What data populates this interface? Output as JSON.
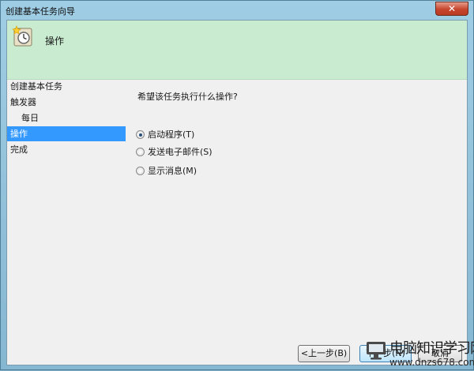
{
  "window": {
    "title": "创建基本任务向导",
    "close_glyph": "✕"
  },
  "header": {
    "title": "操作",
    "icon": "task-scheduler-clock-icon"
  },
  "steps": [
    {
      "label": "创建基本任务",
      "active": false
    },
    {
      "label": "触发器",
      "active": false
    },
    {
      "label": "每日",
      "active": false,
      "sub": true
    },
    {
      "label": "操作",
      "active": true
    },
    {
      "label": "完成",
      "active": false
    }
  ],
  "main": {
    "question": "希望该任务执行什么操作?",
    "options": [
      {
        "label": "启动程序(T)",
        "checked": true
      },
      {
        "label": "发送电子邮件(S)",
        "checked": false
      },
      {
        "label": "显示消息(M)",
        "checked": false
      }
    ]
  },
  "footer": {
    "back_label": "<上一步(B)",
    "next_label": "下一步(N)",
    "cancel_label": "取消"
  },
  "watermark": {
    "title": "电脑知识学习网",
    "url": "www.dnzs678.com"
  },
  "colors": {
    "header_bg": "#c9ecd0",
    "selection": "#3399ff",
    "content_bg": "#f0f0f0"
  }
}
